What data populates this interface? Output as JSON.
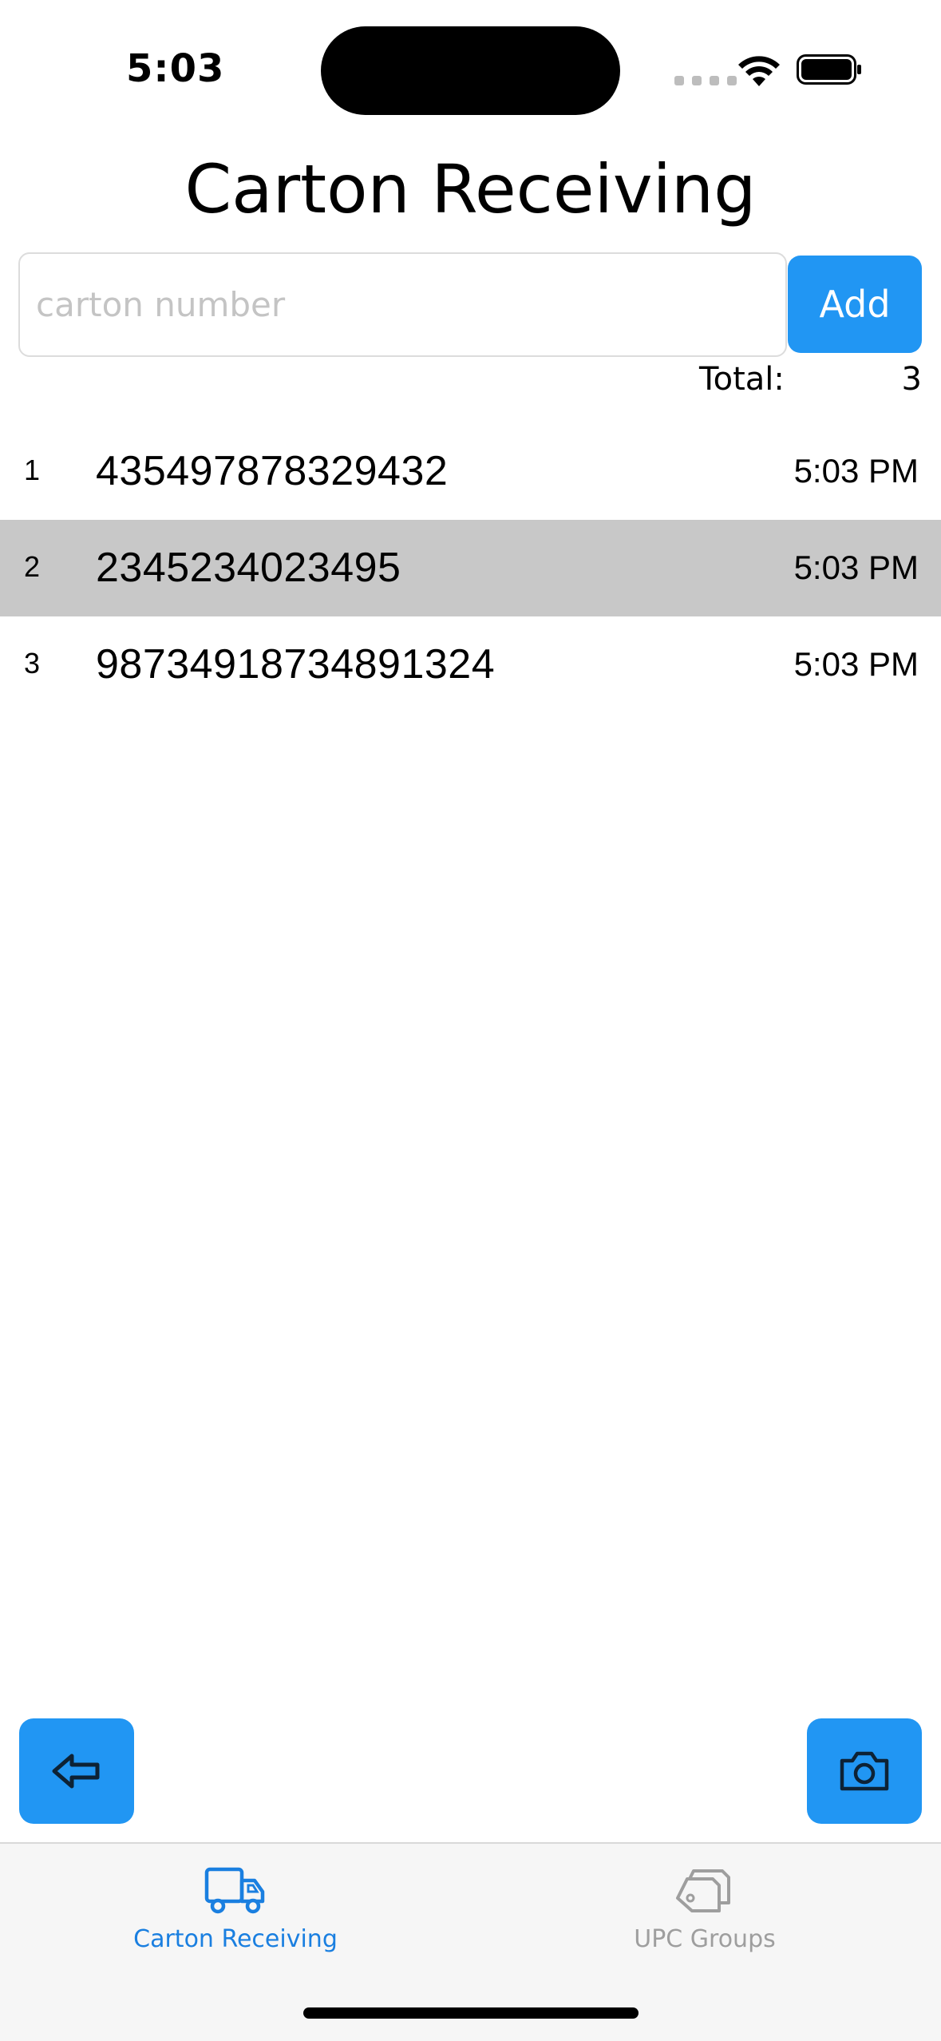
{
  "status_bar": {
    "time": "5:03"
  },
  "page": {
    "title": "Carton Receiving"
  },
  "input": {
    "placeholder": "carton number",
    "value": "",
    "add_label": "Add"
  },
  "total": {
    "label": "Total:",
    "value": "3"
  },
  "cartons": [
    {
      "index": "1",
      "number": "435497878329432",
      "time": "5:03 PM",
      "selected": false
    },
    {
      "index": "2",
      "number": "2345234023495",
      "time": "5:03 PM",
      "selected": true
    },
    {
      "index": "3",
      "number": "98734918734891324",
      "time": "5:03 PM",
      "selected": false
    }
  ],
  "buttons": {
    "back_icon": "back-arrow-icon",
    "camera_icon": "camera-icon"
  },
  "tab_bar": {
    "tabs": [
      {
        "label": "Carton Receiving",
        "icon": "truck-icon",
        "active": true
      },
      {
        "label": "UPC Groups",
        "icon": "tags-icon",
        "active": false
      }
    ]
  },
  "colors": {
    "accent": "#2196f3",
    "active_tab": "#1a7fe0",
    "inactive_tab": "#9e9e9e",
    "selected_row": "#c8c8c8"
  }
}
